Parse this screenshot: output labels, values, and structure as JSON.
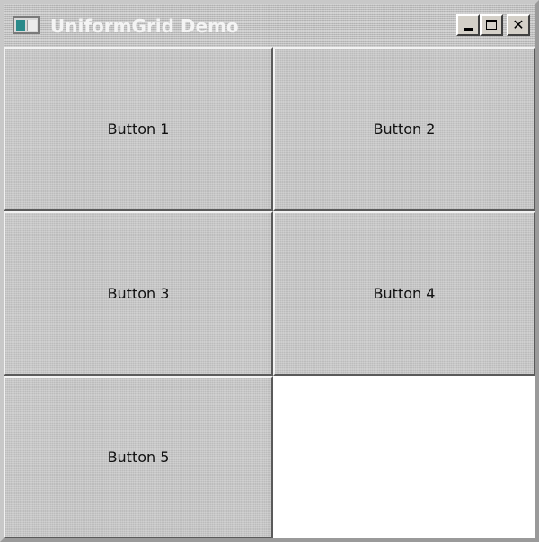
{
  "window": {
    "title": "UniformGrid Demo",
    "icon": "app-window-icon"
  },
  "caption_buttons": {
    "minimize": "minimize-icon",
    "maximize": "maximize-icon",
    "close": "close-icon"
  },
  "grid": {
    "buttons": [
      {
        "label": "Button 1"
      },
      {
        "label": "Button 2"
      },
      {
        "label": "Button 3"
      },
      {
        "label": "Button 4"
      },
      {
        "label": "Button 5"
      }
    ]
  }
}
